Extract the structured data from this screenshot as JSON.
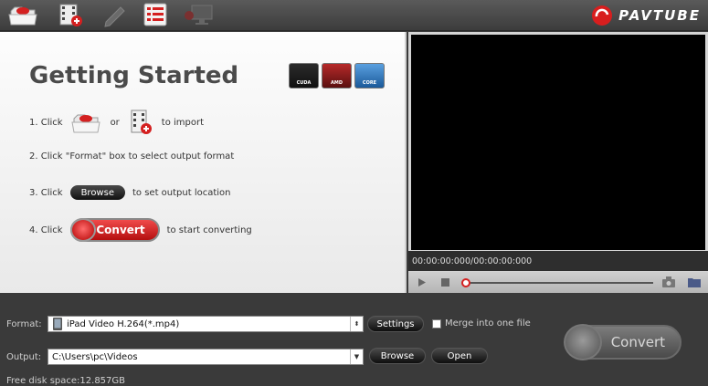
{
  "toolbar": {
    "icons": [
      "open-folder-icon",
      "add-video-icon",
      "edit-icon",
      "task-list-icon",
      "display-icon"
    ],
    "brand": "PAVTUBE"
  },
  "getting_started": {
    "title": "Getting Started",
    "badges": [
      "CUDA",
      "AMD",
      "CORE"
    ],
    "step1_prefix": "1. Click",
    "step1_or": "or",
    "step1_suffix": "to import",
    "step2": "2. Click \"Format\" box to select output format",
    "step3_prefix": "3. Click",
    "step3_button": "Browse",
    "step3_suffix": "to set output location",
    "step4_prefix": "4. Click",
    "step4_button": "Convert",
    "step4_suffix": "to start converting"
  },
  "preview": {
    "timecode": "00:00:00:000/00:00:00:000",
    "progress": 0
  },
  "bottom": {
    "format_label": "Format:",
    "format_value": "iPad Video H.264(*.mp4)",
    "settings_button": "Settings",
    "merge_label": "Merge into one file",
    "merge_checked": false,
    "output_label": "Output:",
    "output_value": "C:\\Users\\pc\\Videos",
    "browse_button": "Browse",
    "open_button": "Open",
    "free_space": "Free disk space:12.857GB",
    "convert_button": "Convert"
  },
  "colors": {
    "accent_red": "#d81e1e",
    "dark_bg": "#3a3a3a"
  }
}
